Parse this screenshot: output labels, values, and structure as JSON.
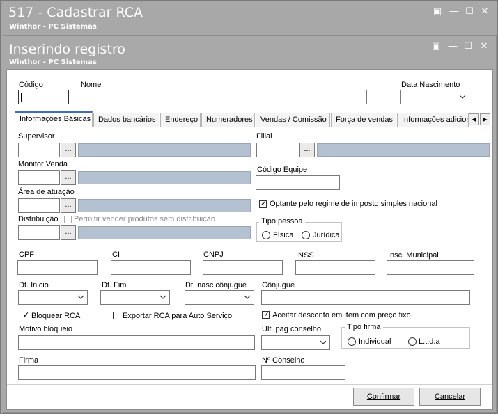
{
  "window": {
    "title": "517 - Cadastrar RCA",
    "subtitle": "Winthor - PC Sistemas"
  },
  "dialog": {
    "title": "Inserindo registro",
    "subtitle": "Winthor - PC Sistemas"
  },
  "header_fields": {
    "codigo_label": "Código",
    "codigo_value": "",
    "nome_label": "Nome",
    "nome_value": "",
    "data_nascimento_label": "Data Nascimento",
    "data_nascimento_value": ""
  },
  "tabs": [
    {
      "label": "Informações Básicas",
      "active": true
    },
    {
      "label": "Dados bancários",
      "active": false
    },
    {
      "label": "Endereço",
      "active": false
    },
    {
      "label": "Numeradores",
      "active": false
    },
    {
      "label": "Vendas  / Comissão",
      "active": false
    },
    {
      "label": "Força de vendas",
      "active": false
    },
    {
      "label": "Informações adicionais",
      "active": false
    }
  ],
  "tab_scroll": {
    "left": "◀",
    "right": "▶"
  },
  "basic": {
    "supervisor_label": "Supervisor",
    "filial_label": "Filial",
    "monitor_label": "Monitor Venda",
    "codigo_equipe_label": "Código Equipe",
    "area_label": "Área de atuação",
    "distribuicao_label": "Distribuição",
    "permitir_label": "Permitir vender produtos sem distribuição",
    "permitir_checked": false,
    "optante_label": "Optante pelo regime de imposto simples nacional",
    "optante_checked": true,
    "tipo_pessoa_title": "Tipo pessoa",
    "fisica_label": "Física",
    "juridica_label": "Jurídica",
    "lookup_button": "..."
  },
  "docs": {
    "cpf_label": "CPF",
    "ci_label": "CI",
    "cnpj_label": "CNPJ",
    "inss_label": "INSS",
    "insc_municipal_label": "Insc. Municipal"
  },
  "dates": {
    "dt_inicio_label": "Dt. Inicio",
    "dt_fim_label": "Dt. Fim",
    "dt_nasc_conjuge_label": "Dt. nasc cônjugue",
    "conjuge_label": "Cônjugue"
  },
  "flags": {
    "bloquear_label": "Bloquear RCA",
    "bloquear_checked": true,
    "exportar_label": "Exportar RCA para Auto Serviço",
    "exportar_checked": false,
    "aceitar_label": "Aceitar desconto em item com preço fixo.",
    "aceitar_checked": true
  },
  "bottom": {
    "motivo_label": "Motivo bloqueio",
    "ult_pag_label": "Ult. pag conselho",
    "tipo_firma_title": "Tipo firma",
    "individual_label": "Individual",
    "ltda_label": "L.t.d.a",
    "firma_label": "Firma",
    "conselho_label": "Nº Conselho"
  },
  "actions": {
    "confirmar": "Confirmar",
    "cancelar": "Cancelar"
  },
  "colors": {
    "titlebar": "#a8a8a8",
    "readonly_field": "#b3c1d1",
    "active_tab_accent": "#3c6fb5"
  },
  "icons": {
    "check": "✓",
    "restore": "▣",
    "minimize": "—",
    "maximize": "☐",
    "close": "✕"
  }
}
